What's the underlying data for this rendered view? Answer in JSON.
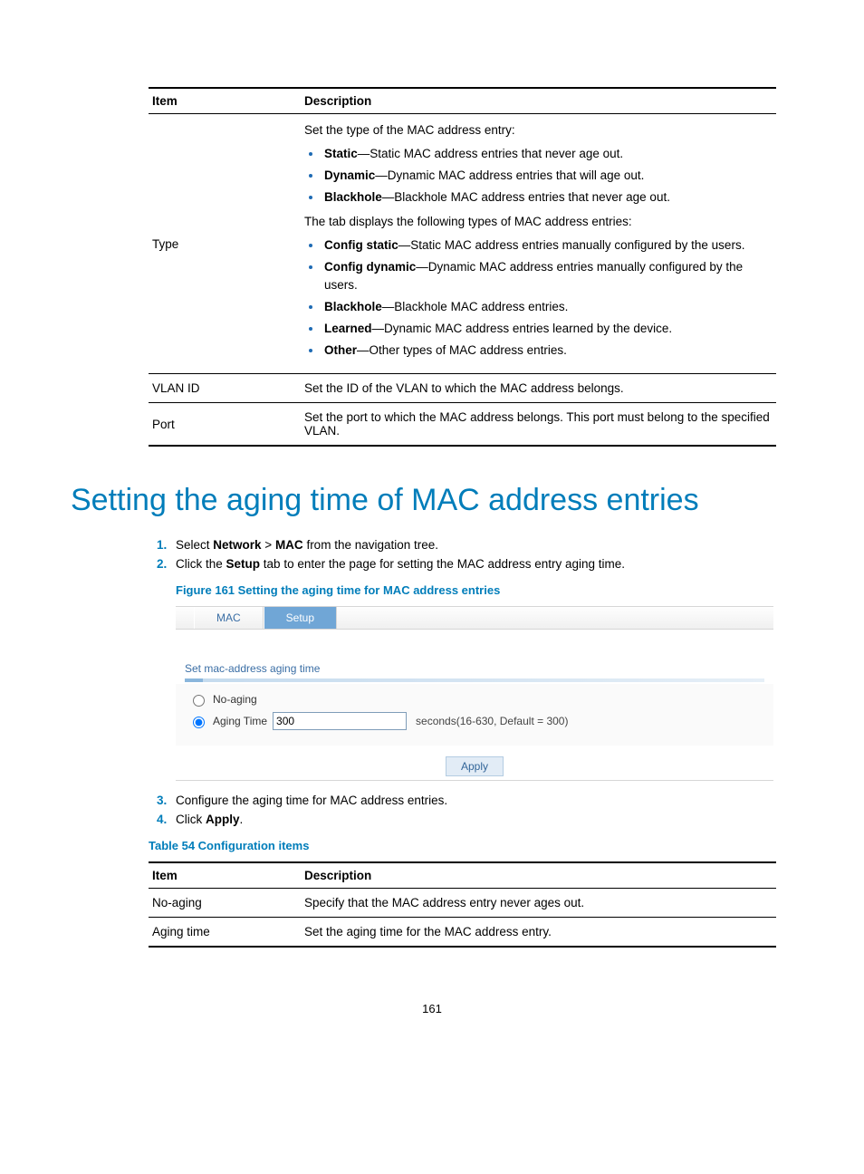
{
  "table1": {
    "headers": {
      "item": "Item",
      "description": "Description"
    },
    "rows": {
      "type": {
        "item": "Type",
        "intro1": "Set the type of the MAC address entry:",
        "list1": [
          {
            "bold": "Static",
            "text": "—Static MAC address entries that never age out."
          },
          {
            "bold": "Dynamic",
            "text": "—Dynamic MAC address entries that will age out."
          },
          {
            "bold": "Blackhole",
            "text": "—Blackhole MAC address entries that never age out."
          }
        ],
        "intro2": "The tab displays the following types of MAC address entries:",
        "list2": [
          {
            "bold": "Config static",
            "text": "—Static MAC address entries manually configured by the users."
          },
          {
            "bold": "Config dynamic",
            "text": "—Dynamic MAC address entries manually configured by the users."
          },
          {
            "bold": "Blackhole",
            "text": "—Blackhole MAC address entries."
          },
          {
            "bold": "Learned",
            "text": "—Dynamic MAC address entries learned by the device."
          },
          {
            "bold": "Other",
            "text": "—Other types of MAC address entries."
          }
        ]
      },
      "vlan": {
        "item": "VLAN ID",
        "desc": "Set the ID of the VLAN to which the MAC address belongs."
      },
      "port": {
        "item": "Port",
        "desc": "Set the port to which the MAC address belongs. This port must belong to the specified VLAN."
      }
    }
  },
  "section_title": "Setting the aging time of MAC address entries",
  "steps": {
    "s1_pre": "Select ",
    "s1_b1": "Network",
    "s1_mid": " > ",
    "s1_b2": "MAC",
    "s1_post": " from the navigation tree.",
    "s2_pre": "Click the ",
    "s2_b": "Setup",
    "s2_post": " tab to enter the page for setting the MAC address entry aging time.",
    "s3": "Configure the aging time for MAC address entries.",
    "s4_pre": "Click ",
    "s4_b": "Apply",
    "s4_post": "."
  },
  "figure_label": "Figure 161 Setting the aging time for MAC address entries",
  "screenshot": {
    "tabs": {
      "mac": "MAC",
      "setup": "Setup"
    },
    "section_caption": "Set mac-address aging time",
    "no_aging_label": "No-aging",
    "aging_time_label": "Aging Time",
    "aging_time_value": "300",
    "hint": "seconds(16-630, Default = 300)",
    "apply": "Apply"
  },
  "table_label": "Table 54 Configuration items",
  "table2": {
    "headers": {
      "item": "Item",
      "description": "Description"
    },
    "rows": {
      "no_aging": {
        "item": "No-aging",
        "desc": "Specify that the MAC address entry never ages out."
      },
      "aging_time": {
        "item": "Aging time",
        "desc": "Set the aging time for the MAC address entry."
      }
    }
  },
  "page_number": "161"
}
